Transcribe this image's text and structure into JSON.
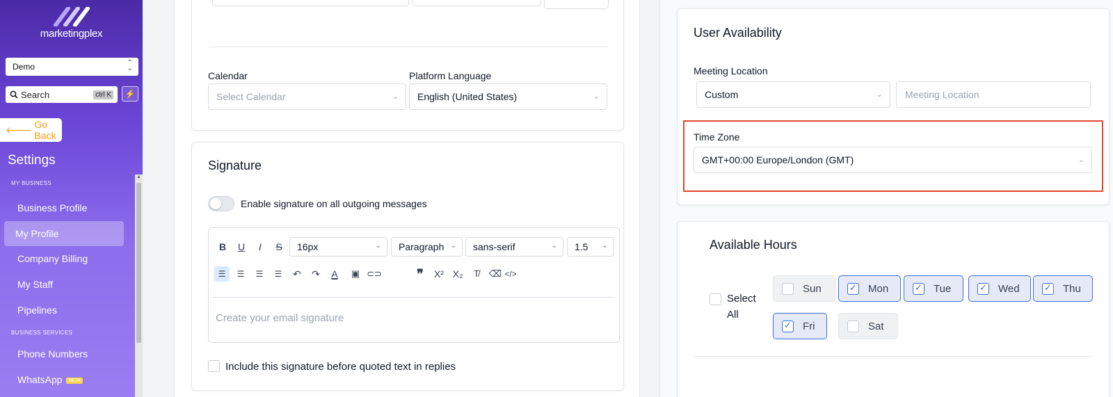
{
  "sidebar": {
    "brand": "marketingplex",
    "location": "Demo",
    "search": {
      "label": "Search",
      "shortcut": "ctrl K"
    },
    "go_back": "Go Back",
    "title": "Settings",
    "sections": [
      {
        "label": "MY BUSINESS",
        "items": [
          "Business Profile",
          "My Profile",
          "Company Billing",
          "My Staff",
          "Pipelines"
        ]
      },
      {
        "label": "BUSINESS SERVICES",
        "items": [
          "Phone Numbers",
          "WhatsApp"
        ]
      }
    ],
    "active_item": "My Profile",
    "whatsapp_badge": "BETA"
  },
  "profile": {
    "calendar_label": "Calendar",
    "calendar_placeholder": "Select Calendar",
    "language_label": "Platform Language",
    "language_value": "English (United States)"
  },
  "signature": {
    "title": "Signature",
    "toggle_label": "Enable signature on all outgoing messages",
    "font_size": "16px",
    "block_type": "Paragraph",
    "font_family": "sans-serif",
    "line_height": "1.5",
    "placeholder": "Create your email signature",
    "include_label": "Include this signature before quoted text in replies"
  },
  "availability": {
    "title": "User Availability",
    "meeting_location_label": "Meeting Location",
    "meeting_location_type": "Custom",
    "meeting_location_placeholder": "Meeting Location",
    "timezone_label": "Time Zone",
    "timezone_value": "GMT+00:00 Europe/London (GMT)"
  },
  "hours": {
    "title": "Available Hours",
    "select_all_line1": "Select",
    "select_all_line2": "All",
    "days": [
      {
        "label": "Sun",
        "checked": false
      },
      {
        "label": "Mon",
        "checked": true
      },
      {
        "label": "Tue",
        "checked": true
      },
      {
        "label": "Wed",
        "checked": true
      },
      {
        "label": "Thu",
        "checked": true
      },
      {
        "label": "Fri",
        "checked": true
      },
      {
        "label": "Sat",
        "checked": false
      }
    ]
  },
  "colors": {
    "accent": "#3b6fd8",
    "highlight": "#e2472c",
    "go_back": "#f59e0b",
    "sidebar": "#7c5ce4"
  }
}
